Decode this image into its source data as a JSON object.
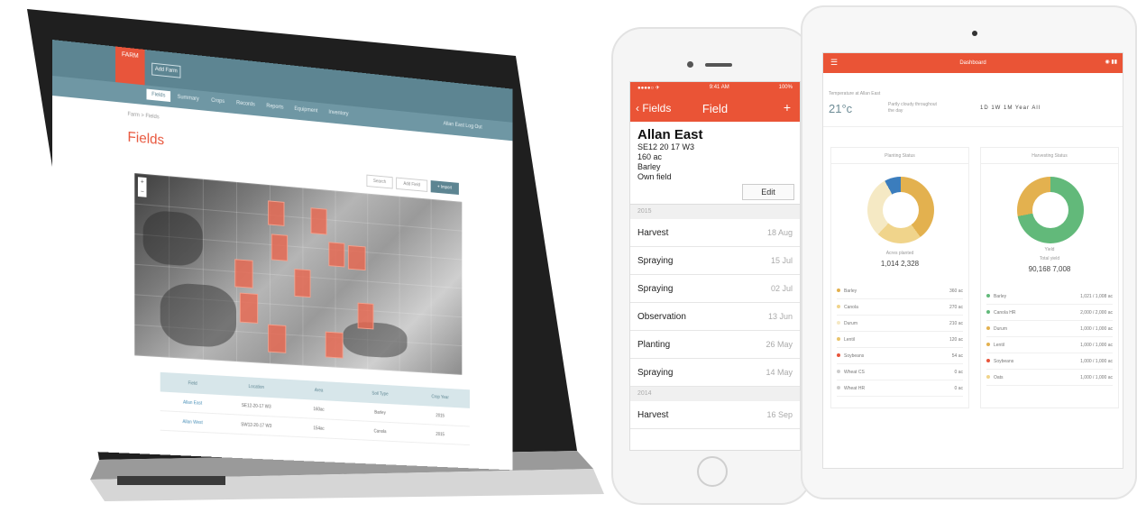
{
  "laptop": {
    "logo_text": "FARM",
    "header_button": "Add Farm",
    "nav": {
      "active_tab": "Fields",
      "items": [
        "Summary",
        "Crops",
        "Records",
        "Reports",
        "Equipment",
        "Inventory"
      ],
      "right": "Allan East  Log Out"
    },
    "breadcrumb": "Farm > Fields",
    "page_title": "Fields",
    "map_tools": [
      "Search",
      "Add Field",
      "+ Import"
    ],
    "table": {
      "headers": [
        "Field",
        "Location",
        "Area",
        "Soil Type",
        "Crop Year"
      ],
      "rows": [
        [
          "Allan East",
          "SE12-20-17 W3",
          "160ac",
          "Barley",
          "2015"
        ],
        [
          "Allan West",
          "SW12-20-17 W3",
          "154ac",
          "Canola",
          "2015"
        ]
      ]
    }
  },
  "phone": {
    "status_left": "●●●●○ ✈",
    "status_time": "9:41 AM",
    "status_right": "100%",
    "back_label": "‹ Fields",
    "title": "Field",
    "plus": "+",
    "field_name": "Allan East",
    "lines": [
      "SE12 20 17 W3",
      "160 ac",
      "Barley",
      "Own field"
    ],
    "edit_label": "Edit",
    "sections": [
      {
        "label": "2015",
        "rows": [
          {
            "activity": "Harvest",
            "date": "18 Aug"
          },
          {
            "activity": "Spraying",
            "date": "15 Jul"
          },
          {
            "activity": "Spraying",
            "date": "02 Jul"
          },
          {
            "activity": "Observation",
            "date": "13 Jun"
          },
          {
            "activity": "Planting",
            "date": "26 May"
          },
          {
            "activity": "Spraying",
            "date": "14 May"
          }
        ]
      },
      {
        "label": "2014",
        "rows": [
          {
            "activity": "Harvest",
            "date": "16 Sep"
          }
        ]
      }
    ]
  },
  "tablet": {
    "nav_title": "Dashboard",
    "menu_icon": "☰",
    "status_icons": "◉ ▮▮",
    "top_caption": "Temperature at Allan East",
    "temperature": "21°c",
    "temp_desc": "Partly cloudy throughout the day",
    "range_buttons": "1D  1W  1M  Year  All",
    "panels": [
      {
        "title": "Planting Status",
        "stat_labels": [
          "Acres planted",
          "Total acres"
        ],
        "stat_values": "1,014   2,328",
        "colors": [
          "#e3b14f",
          "#f0d48b",
          "#f5e9c4",
          "#3b7dbd"
        ],
        "items": [
          {
            "name": "Barley",
            "value": "360 ac",
            "color": "#e3b14f"
          },
          {
            "name": "Canola",
            "value": "270 ac",
            "color": "#f0d48b"
          },
          {
            "name": "Durum",
            "value": "210 ac",
            "color": "#f5e9c4"
          },
          {
            "name": "Lentil",
            "value": "120 ac",
            "color": "#e9c46a"
          },
          {
            "name": "Soybeans",
            "value": "54 ac",
            "color": "#e8553b"
          },
          {
            "name": "Wheat CS",
            "value": "0 ac",
            "color": "#cccccc"
          },
          {
            "name": "Wheat HR",
            "value": "0 ac",
            "color": "#cccccc"
          }
        ]
      },
      {
        "title": "Harvesting Status",
        "center_label": "Yield",
        "stat_labels": [
          "Total yield",
          "Harvested acres"
        ],
        "stat_values": "90,168   7,008",
        "colors": [
          "#62b97a",
          "#e3b14f"
        ],
        "items": [
          {
            "name": "Barley",
            "value": "1,021 / 1,008 ac",
            "color": "#62b97a"
          },
          {
            "name": "Canola HR",
            "value": "2,000 / 2,000 ac",
            "color": "#62b97a"
          },
          {
            "name": "Durum",
            "value": "1,000 / 1,000 ac",
            "color": "#e3b14f"
          },
          {
            "name": "Lentil",
            "value": "1,000 / 1,000 ac",
            "color": "#e3b14f"
          },
          {
            "name": "Soybeans",
            "value": "1,000 / 1,000 ac",
            "color": "#e8553b"
          },
          {
            "name": "Oats",
            "value": "1,000 / 1,000 ac",
            "color": "#f0d48b"
          }
        ]
      }
    ]
  }
}
